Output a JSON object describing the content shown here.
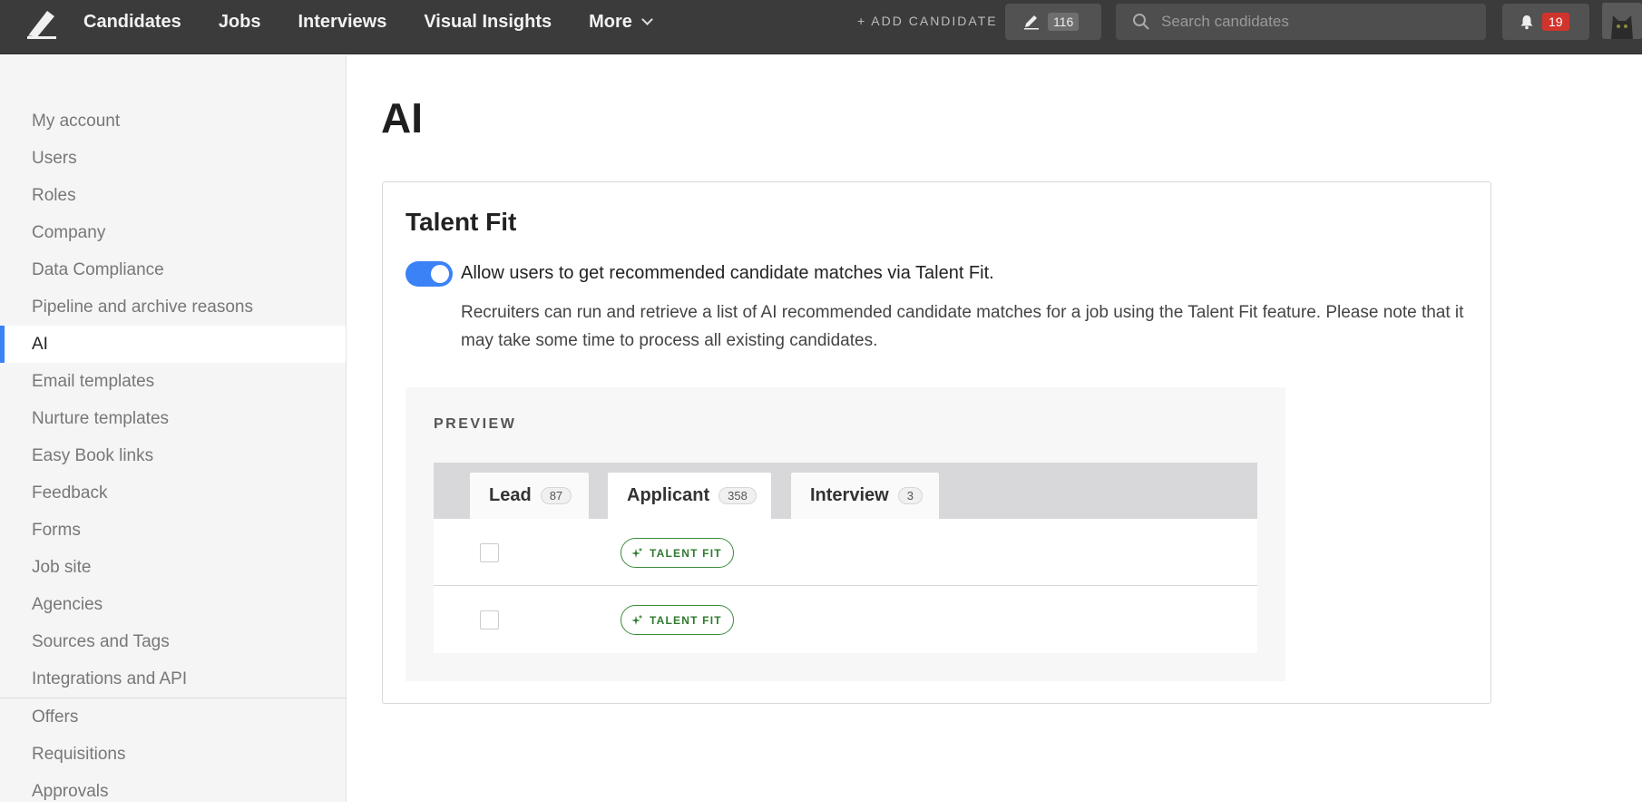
{
  "topbar": {
    "nav": [
      "Candidates",
      "Jobs",
      "Interviews",
      "Visual Insights",
      "More"
    ],
    "add_candidate": "+ ADD CANDIDATE",
    "pen_count": "116",
    "search_placeholder": "Search candidates",
    "notification_count": "19"
  },
  "sidebar": {
    "items": [
      "My account",
      "Users",
      "Roles",
      "Company",
      "Data Compliance",
      "Pipeline and archive reasons",
      "AI",
      "Email templates",
      "Nurture templates",
      "Easy Book links",
      "Feedback",
      "Forms",
      "Job site",
      "Agencies",
      "Sources and Tags",
      "Integrations and API"
    ],
    "items_lower": [
      "Offers",
      "Requisitions",
      "Approvals"
    ],
    "active": "AI"
  },
  "page": {
    "title": "AI"
  },
  "talent_fit": {
    "title": "Talent Fit",
    "toggle_label": "Allow users to get recommended candidate matches via Talent Fit.",
    "toggle_on": true,
    "description": "Recruiters can run and retrieve a list of AI recommended candidate matches for a job using the Talent Fit feature. Please note that it may take some time to process all existing candidates.",
    "preview": {
      "label": "PREVIEW",
      "tabs": [
        {
          "label": "Lead",
          "count": "87"
        },
        {
          "label": "Applicant",
          "count": "358"
        },
        {
          "label": "Interview",
          "count": "3"
        }
      ],
      "badge": "TALENT FIT"
    }
  },
  "colors": {
    "topbar": "#3b3b3b",
    "accent": "#3b82f6",
    "talent_fit_green": "#2f7a2f",
    "alert_red": "#d0342c"
  }
}
